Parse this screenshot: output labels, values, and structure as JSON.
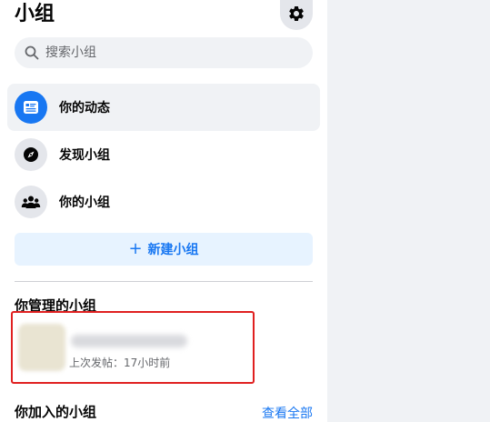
{
  "header": {
    "title": "小组"
  },
  "search": {
    "placeholder": "搜索小组"
  },
  "nav": {
    "items": [
      {
        "label": "你的动态",
        "icon": "feed-icon",
        "active": true
      },
      {
        "label": "发现小组",
        "icon": "compass-icon",
        "active": false
      },
      {
        "label": "你的小组",
        "icon": "groups-icon",
        "active": false
      }
    ]
  },
  "create_button": {
    "label": "新建小组",
    "icon": "plus-icon"
  },
  "managed_section": {
    "title": "你管理的小组",
    "groups": [
      {
        "meta": "上次发帖：17小时前"
      }
    ]
  },
  "joined_section": {
    "title": "你加入的小组",
    "see_all": "查看全部"
  },
  "colors": {
    "accent": "#1877f2",
    "highlight_border": "#e02020",
    "panel_bg": "#ffffff",
    "page_bg": "#f0f2f5"
  }
}
